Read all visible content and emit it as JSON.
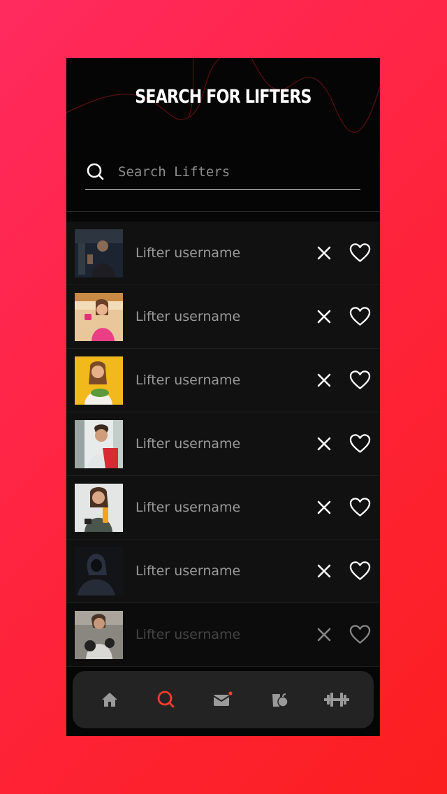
{
  "header": {
    "title": "SEARCH FOR LIFTERS"
  },
  "search": {
    "placeholder": "Search Lifters",
    "value": ""
  },
  "lifters": [
    {
      "username": "Lifter username",
      "photo": "man-in-gym-photo"
    },
    {
      "username": "Lifter username",
      "photo": "woman-with-dumbbell-photo"
    },
    {
      "username": "Lifter username",
      "photo": "woman-eating-salad-photo"
    },
    {
      "username": "Lifter username",
      "photo": "man-with-towel-photo"
    },
    {
      "username": "Lifter username",
      "photo": "woman-with-phone-and-drink-photo"
    },
    {
      "username": "Lifter username",
      "photo": "hooded-person-photo"
    },
    {
      "username": "Lifter username",
      "photo": "woman-boxing-photo"
    }
  ],
  "nav": {
    "items": [
      {
        "icon": "home-icon",
        "active": false
      },
      {
        "icon": "search-icon",
        "active": true
      },
      {
        "icon": "mail-icon",
        "active": false,
        "badge": true
      },
      {
        "icon": "nutrition-icon",
        "active": false
      },
      {
        "icon": "dumbbell-icon",
        "active": false
      }
    ]
  },
  "colors": {
    "accent": "#ff3b2f",
    "background_gradient": [
      "#ff2a5f",
      "#fb1f1f"
    ],
    "panel": "#111111",
    "nav_bg": "#232323",
    "nav_icon": "#9a9a9a"
  }
}
